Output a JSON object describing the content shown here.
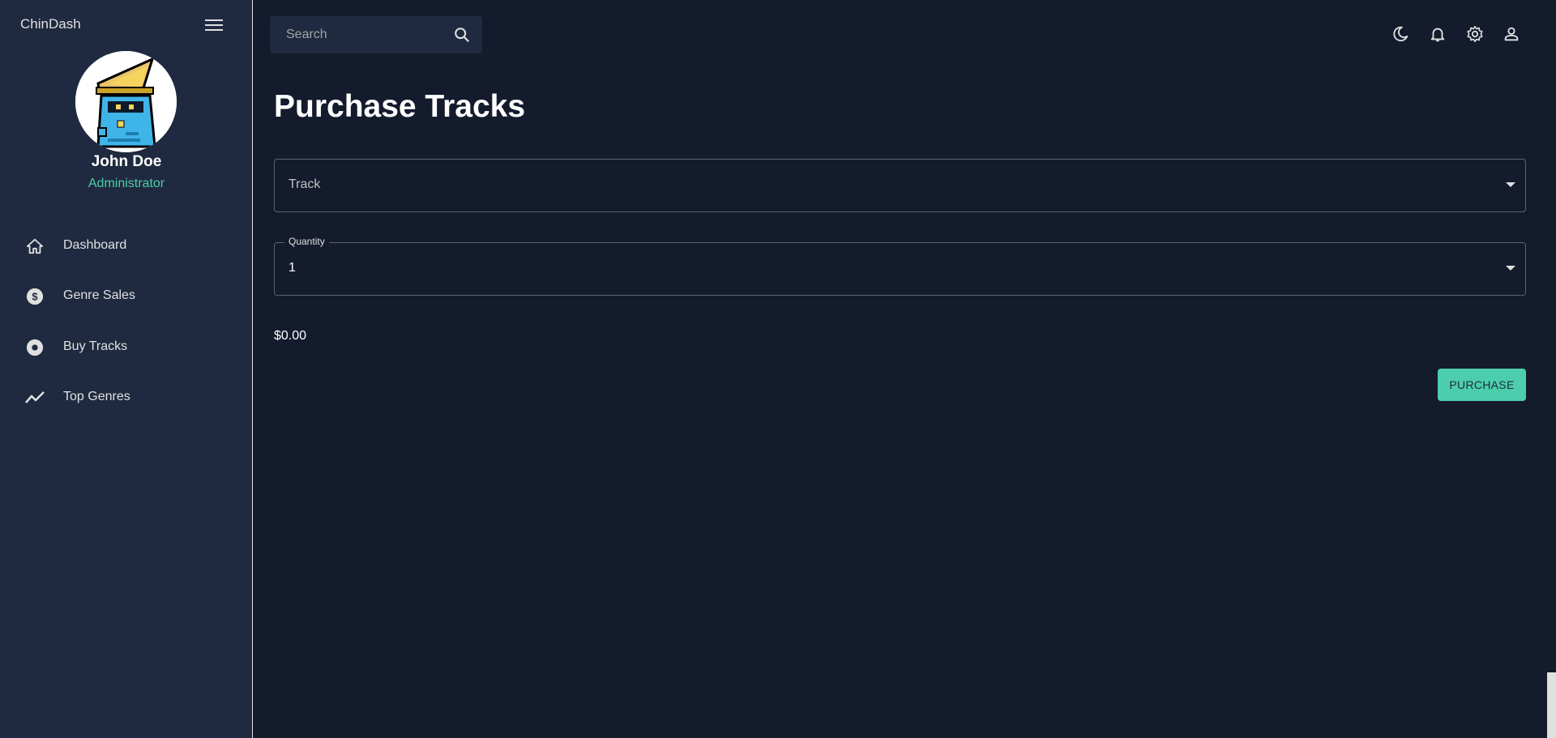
{
  "sidebar": {
    "brand": "ChinDash",
    "user": {
      "name": "John Doe",
      "role": "Administrator"
    },
    "items": [
      {
        "label": "Dashboard",
        "icon": "home-icon"
      },
      {
        "label": "Genre Sales",
        "icon": "dollar-icon"
      },
      {
        "label": "Buy Tracks",
        "icon": "disc-icon"
      },
      {
        "label": "Top Genres",
        "icon": "trending-icon"
      }
    ]
  },
  "topbar": {
    "search_placeholder": "Search",
    "icons": [
      "moon-icon",
      "bell-icon",
      "gear-icon",
      "person-icon"
    ]
  },
  "main": {
    "title": "Purchase Tracks",
    "track_field": {
      "value": "Track"
    },
    "quantity_field": {
      "label": "Quantity",
      "value": "1"
    },
    "price": "$0.00",
    "purchase_label": "PURCHASE"
  },
  "colors": {
    "background": "#141b2d",
    "sidebar": "#1f2a40",
    "accent": "#4cceac",
    "text": "#e0e0e0"
  }
}
